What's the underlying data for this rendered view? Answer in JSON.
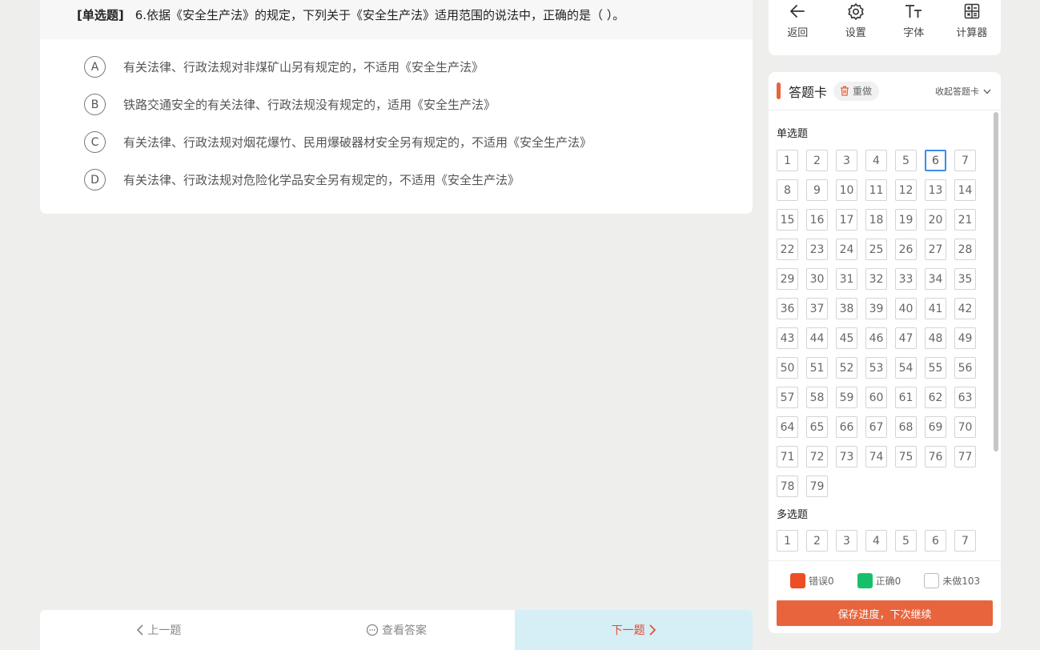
{
  "question": {
    "type_label": "[单选题]",
    "stem": "6.依据《安全生产法》的规定，下列关于《安全生产法》适用范围的说法中，正确的是（ ）。",
    "options": [
      {
        "letter": "A",
        "text": "有关法律、行政法规对非煤矿山另有规定的，不适用《安全生产法》"
      },
      {
        "letter": "B",
        "text": "铁路交通安全的有关法律、行政法规没有规定的，适用《安全生产法》"
      },
      {
        "letter": "C",
        "text": "有关法律、行政法规对烟花爆竹、民用爆破器材安全另有规定的，不适用《安全生产法》"
      },
      {
        "letter": "D",
        "text": "有关法律、行政法规对危险化学品安全另有规定的，不适用《安全生产法》"
      }
    ]
  },
  "nav": {
    "prev_label": "上一题",
    "answer_label": "查看答案",
    "next_label": "下一题"
  },
  "toolbar": {
    "back_label": "返回",
    "settings_label": "设置",
    "font_label": "字体",
    "calculator_label": "计算器"
  },
  "answer_card": {
    "title": "答题卡",
    "redo_label": "重做",
    "collapse_label": "收起答题卡",
    "single_section_label": "单选题",
    "single_count": 79,
    "current_number": 6,
    "multi_section_label": "多选题",
    "multi_visible_count": 7,
    "legend": {
      "wrong_label": "错误0",
      "right_label": "正确0",
      "todo_label": "未做103"
    },
    "save_label": "保存进度，下次继续"
  },
  "colors": {
    "accent": "#e8643c",
    "current_border": "#3a8ee6",
    "wrong": "#ee4e24",
    "right": "#16c06b",
    "next_bg": "#d6eef5"
  }
}
